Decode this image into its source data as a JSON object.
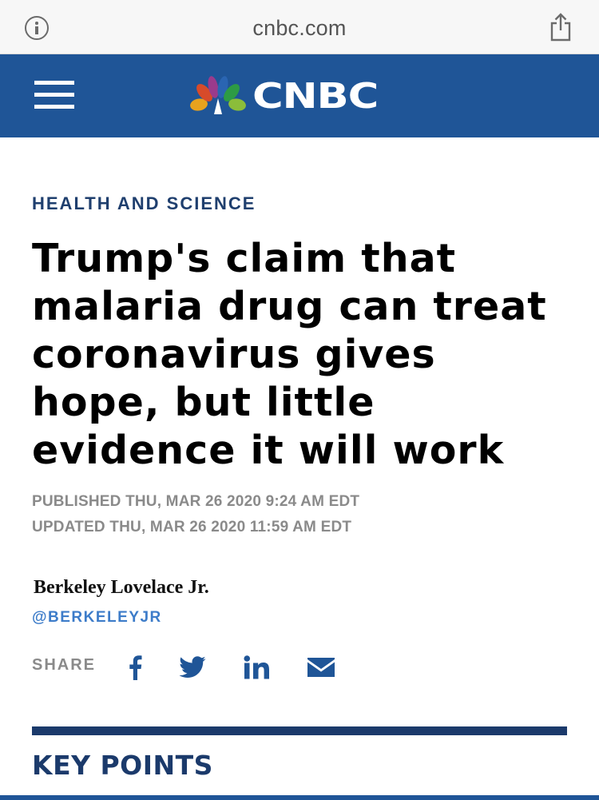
{
  "browser": {
    "url": "cnbc.com"
  },
  "header": {
    "brand": "CNBC",
    "background_color": "#1f5597"
  },
  "article": {
    "section": "HEALTH AND SCIENCE",
    "headline_lines": [
      "Trump's claim that",
      "malaria drug can treat",
      "coronavirus gives",
      "hope, but little",
      "evidence it will work"
    ],
    "published": "PUBLISHED THU, MAR 26 2020 9:24 AM EDT",
    "updated": "UPDATED THU, MAR 26 2020 11:59 AM EDT",
    "author": "Berkeley Lovelace Jr.",
    "author_handle": "@BERKELEYJR",
    "share_label": "SHARE",
    "share_icons": [
      "facebook-icon",
      "twitter-icon",
      "linkedin-icon",
      "email-icon"
    ],
    "key_points_heading": "KEY POINTS"
  },
  "colors": {
    "section_label": "#1f3f6e",
    "handle": "#3d7cc9",
    "share_icon": "#1f5597",
    "rule": "#1b3a6b"
  }
}
